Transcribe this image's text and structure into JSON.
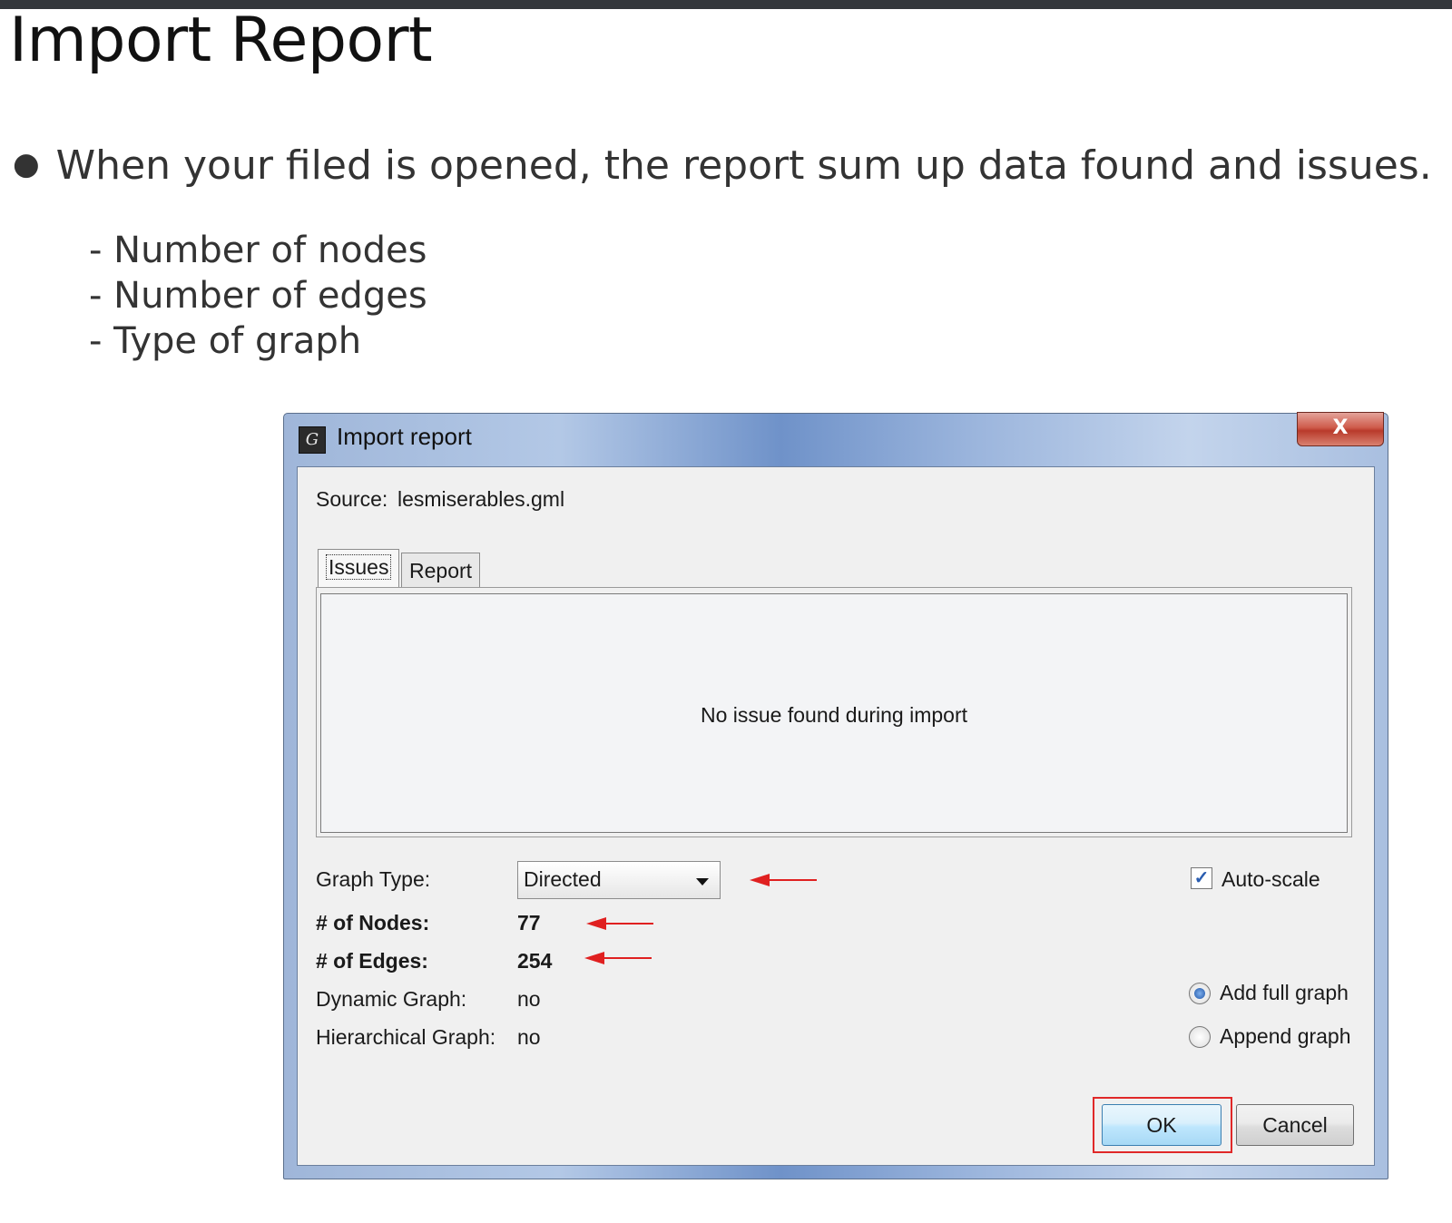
{
  "slide": {
    "title": "Import Report",
    "bullet": "When your filed is opened, the report sum up data found and issues.",
    "subitems": [
      "- Number of nodes",
      "- Number of edges",
      "- Type of graph"
    ]
  },
  "dialog": {
    "title": "Import report",
    "close_label": "X",
    "source_label": "Source:",
    "source_value": "lesmiserables.gml",
    "tabs": [
      {
        "label": "Issues",
        "active": true
      },
      {
        "label": "Report",
        "active": false
      }
    ],
    "issues_message": "No issue found during import",
    "graph_type_label": "Graph Type:",
    "graph_type_value": "Directed",
    "auto_scale_label": "Auto-scale",
    "auto_scale_checked": true,
    "nodes_label": "# of Nodes:",
    "nodes_value": "77",
    "edges_label": "# of Edges:",
    "edges_value": "254",
    "dynamic_label": "Dynamic Graph:",
    "dynamic_value": "no",
    "hierarchical_label": "Hierarchical Graph:",
    "hierarchical_value": "no",
    "radio_options": [
      {
        "label": "Add full graph",
        "selected": true
      },
      {
        "label": "Append graph",
        "selected": false
      }
    ],
    "ok_label": "OK",
    "cancel_label": "Cancel"
  },
  "colors": {
    "annotation_red": "#e02020",
    "titlebar_blue": "#6f92c9",
    "dialog_bg": "#f0f0f0"
  }
}
